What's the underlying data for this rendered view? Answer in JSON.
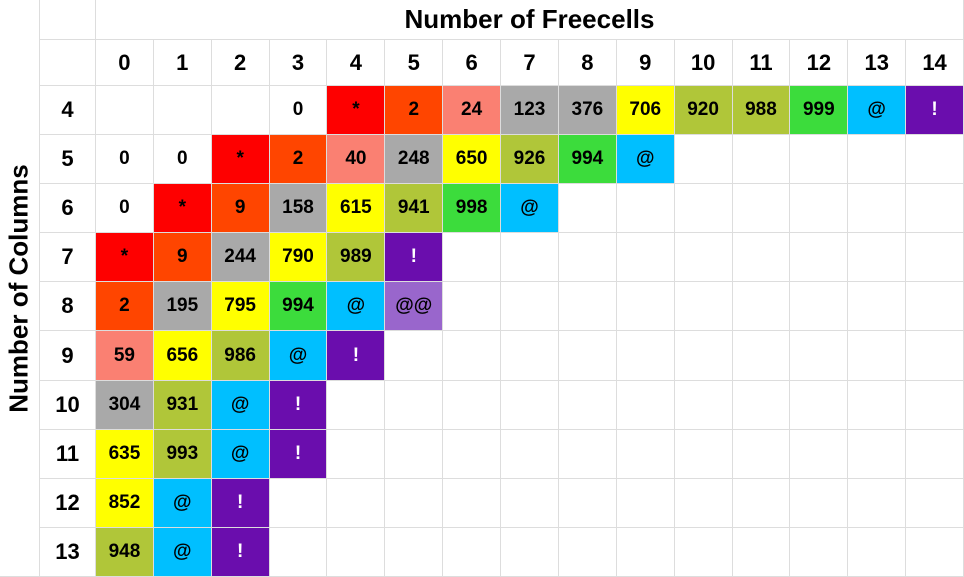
{
  "chart_data": {
    "type": "table",
    "title": "Number of Freecells",
    "ylabel": "Number of Columns",
    "col_headers": [
      "0",
      "1",
      "2",
      "3",
      "4",
      "5",
      "6",
      "7",
      "8",
      "9",
      "10",
      "11",
      "12",
      "13",
      "14"
    ],
    "row_headers": [
      "4",
      "5",
      "6",
      "7",
      "8",
      "9",
      "10",
      "11",
      "12",
      "13"
    ],
    "cells": [
      [
        {
          "v": "",
          "c": "none"
        },
        {
          "v": "",
          "c": "none"
        },
        {
          "v": "",
          "c": "none"
        },
        {
          "v": "0",
          "c": "none"
        },
        {
          "v": "*",
          "c": "red"
        },
        {
          "v": "2",
          "c": "orange"
        },
        {
          "v": "24",
          "c": "pink"
        },
        {
          "v": "123",
          "c": "gray"
        },
        {
          "v": "376",
          "c": "gray"
        },
        {
          "v": "706",
          "c": "yellow"
        },
        {
          "v": "920",
          "c": "olive"
        },
        {
          "v": "988",
          "c": "olive"
        },
        {
          "v": "999",
          "c": "green"
        },
        {
          "v": "@",
          "c": "cyan"
        },
        {
          "v": "!",
          "c": "purple"
        }
      ],
      [
        {
          "v": "0",
          "c": "none"
        },
        {
          "v": "0",
          "c": "none"
        },
        {
          "v": "*",
          "c": "red"
        },
        {
          "v": "2",
          "c": "orange"
        },
        {
          "v": "40",
          "c": "pink"
        },
        {
          "v": "248",
          "c": "gray"
        },
        {
          "v": "650",
          "c": "yellow"
        },
        {
          "v": "926",
          "c": "olive"
        },
        {
          "v": "994",
          "c": "green"
        },
        {
          "v": "@",
          "c": "cyan"
        },
        {
          "v": "",
          "c": "none"
        },
        {
          "v": "",
          "c": "none"
        },
        {
          "v": "",
          "c": "none"
        },
        {
          "v": "",
          "c": "none"
        },
        {
          "v": "",
          "c": "none"
        }
      ],
      [
        {
          "v": "0",
          "c": "none"
        },
        {
          "v": "*",
          "c": "red"
        },
        {
          "v": "9",
          "c": "orange"
        },
        {
          "v": "158",
          "c": "gray"
        },
        {
          "v": "615",
          "c": "yellow"
        },
        {
          "v": "941",
          "c": "olive"
        },
        {
          "v": "998",
          "c": "green"
        },
        {
          "v": "@",
          "c": "cyan"
        },
        {
          "v": "",
          "c": "none"
        },
        {
          "v": "",
          "c": "none"
        },
        {
          "v": "",
          "c": "none"
        },
        {
          "v": "",
          "c": "none"
        },
        {
          "v": "",
          "c": "none"
        },
        {
          "v": "",
          "c": "none"
        },
        {
          "v": "",
          "c": "none"
        }
      ],
      [
        {
          "v": "*",
          "c": "red"
        },
        {
          "v": "9",
          "c": "orange"
        },
        {
          "v": "244",
          "c": "gray"
        },
        {
          "v": "790",
          "c": "yellow"
        },
        {
          "v": "989",
          "c": "olive"
        },
        {
          "v": "!",
          "c": "purple"
        },
        {
          "v": "",
          "c": "none"
        },
        {
          "v": "",
          "c": "none"
        },
        {
          "v": "",
          "c": "none"
        },
        {
          "v": "",
          "c": "none"
        },
        {
          "v": "",
          "c": "none"
        },
        {
          "v": "",
          "c": "none"
        },
        {
          "v": "",
          "c": "none"
        },
        {
          "v": "",
          "c": "none"
        },
        {
          "v": "",
          "c": "none"
        }
      ],
      [
        {
          "v": "2",
          "c": "orange"
        },
        {
          "v": "195",
          "c": "gray"
        },
        {
          "v": "795",
          "c": "yellow"
        },
        {
          "v": "994",
          "c": "green"
        },
        {
          "v": "@",
          "c": "cyan"
        },
        {
          "v": "@@",
          "c": "mauve"
        },
        {
          "v": "",
          "c": "none"
        },
        {
          "v": "",
          "c": "none"
        },
        {
          "v": "",
          "c": "none"
        },
        {
          "v": "",
          "c": "none"
        },
        {
          "v": "",
          "c": "none"
        },
        {
          "v": "",
          "c": "none"
        },
        {
          "v": "",
          "c": "none"
        },
        {
          "v": "",
          "c": "none"
        },
        {
          "v": "",
          "c": "none"
        }
      ],
      [
        {
          "v": "59",
          "c": "pink"
        },
        {
          "v": "656",
          "c": "yellow"
        },
        {
          "v": "986",
          "c": "olive"
        },
        {
          "v": "@",
          "c": "cyan"
        },
        {
          "v": "!",
          "c": "purple"
        },
        {
          "v": "",
          "c": "none"
        },
        {
          "v": "",
          "c": "none"
        },
        {
          "v": "",
          "c": "none"
        },
        {
          "v": "",
          "c": "none"
        },
        {
          "v": "",
          "c": "none"
        },
        {
          "v": "",
          "c": "none"
        },
        {
          "v": "",
          "c": "none"
        },
        {
          "v": "",
          "c": "none"
        },
        {
          "v": "",
          "c": "none"
        },
        {
          "v": "",
          "c": "none"
        }
      ],
      [
        {
          "v": "304",
          "c": "gray"
        },
        {
          "v": "931",
          "c": "olive"
        },
        {
          "v": "@",
          "c": "cyan"
        },
        {
          "v": "!",
          "c": "purple"
        },
        {
          "v": "",
          "c": "none"
        },
        {
          "v": "",
          "c": "none"
        },
        {
          "v": "",
          "c": "none"
        },
        {
          "v": "",
          "c": "none"
        },
        {
          "v": "",
          "c": "none"
        },
        {
          "v": "",
          "c": "none"
        },
        {
          "v": "",
          "c": "none"
        },
        {
          "v": "",
          "c": "none"
        },
        {
          "v": "",
          "c": "none"
        },
        {
          "v": "",
          "c": "none"
        },
        {
          "v": "",
          "c": "none"
        }
      ],
      [
        {
          "v": "635",
          "c": "yellow"
        },
        {
          "v": "993",
          "c": "olive"
        },
        {
          "v": "@",
          "c": "cyan"
        },
        {
          "v": "!",
          "c": "purple"
        },
        {
          "v": "",
          "c": "none"
        },
        {
          "v": "",
          "c": "none"
        },
        {
          "v": "",
          "c": "none"
        },
        {
          "v": "",
          "c": "none"
        },
        {
          "v": "",
          "c": "none"
        },
        {
          "v": "",
          "c": "none"
        },
        {
          "v": "",
          "c": "none"
        },
        {
          "v": "",
          "c": "none"
        },
        {
          "v": "",
          "c": "none"
        },
        {
          "v": "",
          "c": "none"
        },
        {
          "v": "",
          "c": "none"
        }
      ],
      [
        {
          "v": "852",
          "c": "yellow"
        },
        {
          "v": "@",
          "c": "cyan"
        },
        {
          "v": "!",
          "c": "purple"
        },
        {
          "v": "",
          "c": "none"
        },
        {
          "v": "",
          "c": "none"
        },
        {
          "v": "",
          "c": "none"
        },
        {
          "v": "",
          "c": "none"
        },
        {
          "v": "",
          "c": "none"
        },
        {
          "v": "",
          "c": "none"
        },
        {
          "v": "",
          "c": "none"
        },
        {
          "v": "",
          "c": "none"
        },
        {
          "v": "",
          "c": "none"
        },
        {
          "v": "",
          "c": "none"
        },
        {
          "v": "",
          "c": "none"
        },
        {
          "v": "",
          "c": "none"
        }
      ],
      [
        {
          "v": "948",
          "c": "olive"
        },
        {
          "v": "@",
          "c": "cyan"
        },
        {
          "v": "!",
          "c": "purple"
        },
        {
          "v": "",
          "c": "none"
        },
        {
          "v": "",
          "c": "none"
        },
        {
          "v": "",
          "c": "none"
        },
        {
          "v": "",
          "c": "none"
        },
        {
          "v": "",
          "c": "none"
        },
        {
          "v": "",
          "c": "none"
        },
        {
          "v": "",
          "c": "none"
        },
        {
          "v": "",
          "c": "none"
        },
        {
          "v": "",
          "c": "none"
        },
        {
          "v": "",
          "c": "none"
        },
        {
          "v": "",
          "c": "none"
        },
        {
          "v": "",
          "c": "none"
        }
      ]
    ]
  }
}
